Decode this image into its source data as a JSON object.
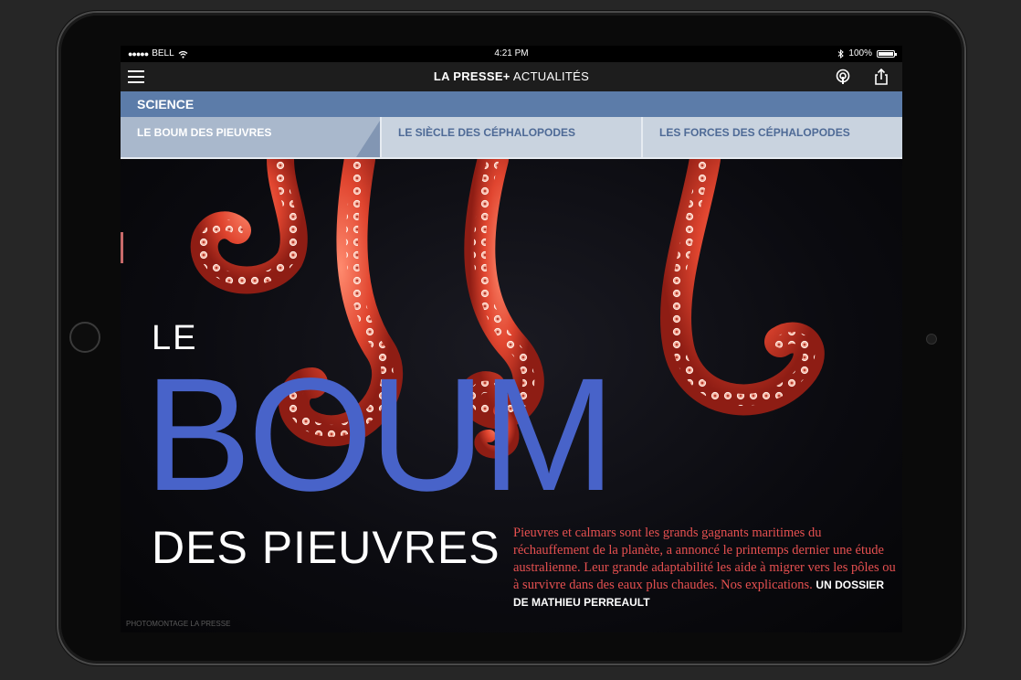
{
  "status": {
    "carrier": "BELL",
    "signal_dots": "●●●●●",
    "time": "4:21 PM",
    "battery": "100%"
  },
  "nav": {
    "brand_bold": "LA PRESSE+",
    "brand_light": "ACTUALITÉS"
  },
  "section": {
    "label": "SCIENCE"
  },
  "tabs": [
    {
      "label": "LE BOUM DES PIEUVRES",
      "active": true
    },
    {
      "label": "LE SIÈCLE DES CÉPHALOPODES",
      "active": false
    },
    {
      "label": "LES FORCES DES CÉPHALOPODES",
      "active": false
    }
  ],
  "hero": {
    "title_le": "LE",
    "title_boum": "BOUM",
    "title_des": "DES PIEUVRES",
    "intro": "Pieuvres et calmars sont les grands gagnants maritimes du réchauffement de la planète, a annoncé le printemps dernier une étude australienne. Leur grande adaptabilité les aide à migrer vers les pôles ou à survivre dans des eaux plus chaudes. Nos explications.",
    "byline": "UN DOSSIER DE MATHIEU PERREAULT",
    "photo_credit": "PHOTOMONTAGE LA PRESSE"
  },
  "colors": {
    "section_bar": "#5c7ca9",
    "tab_bg": "#c9d3df",
    "tab_active_bg": "#a9b8cc",
    "title_blue": "#4863c9",
    "intro_red": "#e65050",
    "tentacle": "#d9412e"
  }
}
